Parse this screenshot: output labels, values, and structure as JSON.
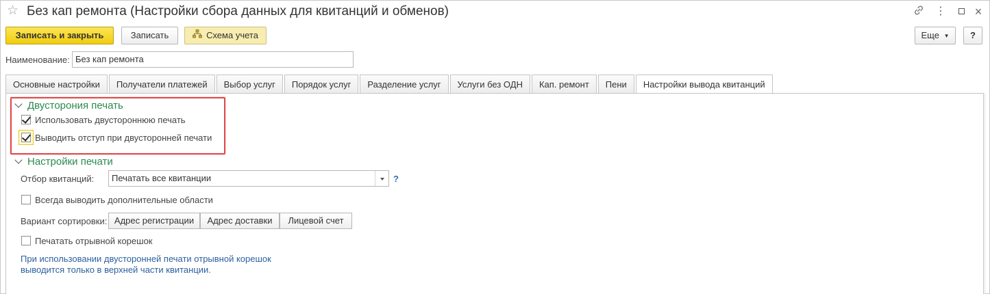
{
  "window": {
    "title": "Без кап ремонта (Настройки сбора данных для квитанций и обменов)",
    "star_icon": "star-icon",
    "link_icon": "link-icon",
    "menu_icon": "more-vertical-icon",
    "maximize_icon": "maximize-icon",
    "close_icon": "close-icon"
  },
  "toolbar": {
    "save_close_label": "Записать и закрыть",
    "save_label": "Записать",
    "schema_label": "Схема учета",
    "more_label": "Еще",
    "help_label": "?"
  },
  "name_field": {
    "label": "Наименование:",
    "value": "Без кап ремонта"
  },
  "tabs": [
    {
      "label": "Основные настройки",
      "active": false
    },
    {
      "label": "Получатели платежей",
      "active": false
    },
    {
      "label": "Выбор услуг",
      "active": false
    },
    {
      "label": "Порядок услуг",
      "active": false
    },
    {
      "label": "Разделение услуг",
      "active": false
    },
    {
      "label": "Услуги без ОДН",
      "active": false
    },
    {
      "label": "Кап. ремонт",
      "active": false
    },
    {
      "label": "Пени",
      "active": false
    },
    {
      "label": "Настройки вывода квитанций",
      "active": true
    }
  ],
  "duplex_group": {
    "title": "Двусторония печать",
    "use_duplex": {
      "label": "Использовать двустороннюю печать",
      "checked": true
    },
    "indent_duplex": {
      "label": "Выводить отступ при двусторонней печати",
      "checked": true
    }
  },
  "print_group": {
    "title": "Настройки печати",
    "filter_label": "Отбор квитанций:",
    "filter_value": "Печатать все квитанции",
    "filter_help": "?",
    "extra_areas": {
      "label": "Всегда выводить дополнительные области",
      "checked": false
    },
    "sort_label": "Вариант сортировки:",
    "sort_options": [
      "Адрес регистрации",
      "Адрес доставки",
      "Лицевой счет"
    ],
    "stub": {
      "label": "Печатать отрывной корешок",
      "checked": false
    },
    "note_line1": "При использовании двусторонней печати отрывной корешок",
    "note_line2": "выводится только в верхней части квитанции."
  },
  "colors": {
    "accent_button": "#f0cc10",
    "group_title": "#2a8a4e",
    "note_text": "#2c5f9e",
    "highlight_frame": "#e04848"
  }
}
